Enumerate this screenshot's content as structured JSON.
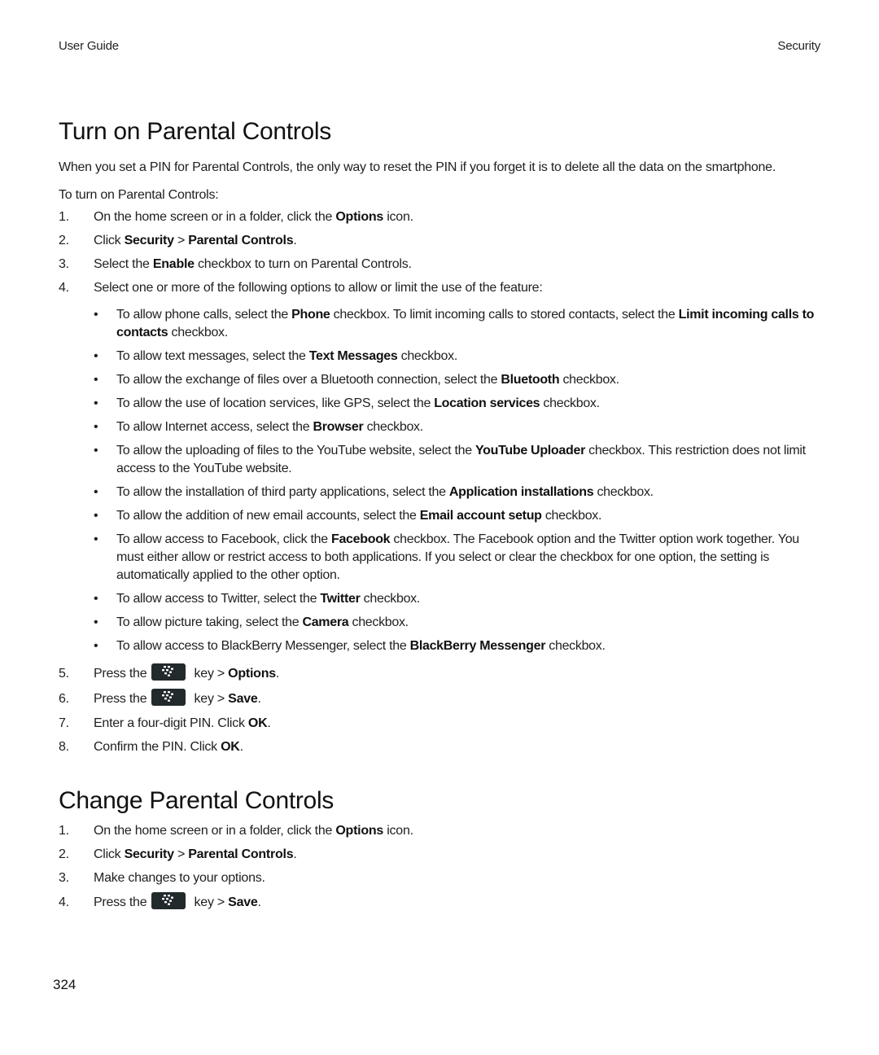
{
  "header": {
    "left": "User Guide",
    "right": "Security"
  },
  "section1": {
    "title": "Turn on Parental Controls",
    "intro": "When you set a PIN for Parental Controls, the only way to reset the PIN if you forget it is to delete all the data on the smartphone.",
    "lead": "To turn on Parental Controls:",
    "steps": [
      {
        "num": "1.",
        "pre": "On the home screen or in a folder, click the ",
        "b1": "Options",
        "post": " icon."
      },
      {
        "num": "2.",
        "pre": "Click ",
        "b1": "Security",
        "mid": " > ",
        "b2": "Parental Controls",
        "post": "."
      },
      {
        "num": "3.",
        "pre": "Select the ",
        "b1": "Enable",
        "post": " checkbox to turn on Parental Controls."
      },
      {
        "num": "4.",
        "text": "Select one or more of the following options to allow or limit the use of the feature:"
      },
      {
        "num": "5.",
        "pre": "Press the",
        "post_key": " key > ",
        "b1": "Options",
        "post": "."
      },
      {
        "num": "6.",
        "pre": "Press the",
        "post_key": " key > ",
        "b1": "Save",
        "post": "."
      },
      {
        "num": "7.",
        "pre": "Enter a four-digit PIN. Click ",
        "b1": "OK",
        "post": "."
      },
      {
        "num": "8.",
        "pre": "Confirm the PIN. Click ",
        "b1": "OK",
        "post": "."
      }
    ],
    "bullet_char": "•",
    "bullets": [
      {
        "pre": "To allow phone calls, select the ",
        "b1": "Phone",
        "mid": " checkbox. To limit incoming calls to stored contacts, select the ",
        "b2": "Limit incoming calls to contacts",
        "post": " checkbox."
      },
      {
        "pre": "To allow text messages, select the ",
        "b1": "Text Messages",
        "post": " checkbox."
      },
      {
        "pre": "To allow the exchange of files over a Bluetooth connection, select the ",
        "b1": "Bluetooth",
        "post": " checkbox."
      },
      {
        "pre": "To allow the use of location services, like GPS, select the ",
        "b1": "Location services",
        "post": " checkbox."
      },
      {
        "pre": "To allow Internet access, select the ",
        "b1": "Browser",
        "post": " checkbox."
      },
      {
        "pre": "To allow the uploading of files to the YouTube website, select the ",
        "b1": "YouTube Uploader",
        "post": " checkbox. This restriction does not limit access to the YouTube website."
      },
      {
        "pre": "To allow the installation of third party applications, select the ",
        "b1": "Application installations",
        "post": " checkbox."
      },
      {
        "pre": "To allow the addition of new email accounts, select the ",
        "b1": "Email account setup",
        "post": " checkbox."
      },
      {
        "pre": "To allow access to Facebook, click the ",
        "b1": "Facebook",
        "post": " checkbox. The Facebook option and the Twitter option work together. You must either allow or restrict access to both applications. If you select or clear the checkbox for one option, the setting is automatically applied to the other option."
      },
      {
        "pre": "To allow access to Twitter, select the ",
        "b1": "Twitter",
        "post": " checkbox."
      },
      {
        "pre": "To allow picture taking, select the ",
        "b1": "Camera",
        "post": " checkbox."
      },
      {
        "pre": "To allow access to BlackBerry Messenger, select the ",
        "b1": "BlackBerry Messenger",
        "post": " checkbox."
      }
    ]
  },
  "section2": {
    "title": "Change Parental Controls",
    "steps": [
      {
        "num": "1.",
        "pre": "On the home screen or in a folder, click the ",
        "b1": "Options",
        "post": " icon."
      },
      {
        "num": "2.",
        "pre": "Click ",
        "b1": "Security",
        "mid": " > ",
        "b2": "Parental Controls",
        "post": "."
      },
      {
        "num": "3.",
        "text": "Make changes to your options."
      },
      {
        "num": "4.",
        "pre": "Press the",
        "post_key": " key > ",
        "b1": "Save",
        "post": "."
      }
    ]
  },
  "icons": {
    "menu_key": "blackberry-menu-key-icon"
  },
  "footer": {
    "page_number": "324"
  }
}
